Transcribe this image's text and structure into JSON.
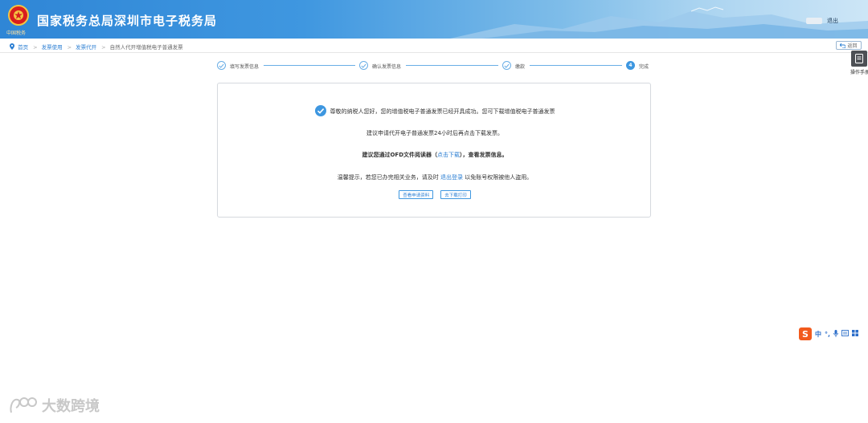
{
  "header": {
    "logo_caption": "中国税务",
    "title": "国家税务总局深圳市电子税务局",
    "logout": "退出"
  },
  "breadcrumb": {
    "items": [
      "首页",
      "发票使用",
      "发票代开",
      "自然人代开增值税电子普通发票"
    ]
  },
  "back_button": "返回",
  "guide_label": "操作手册",
  "steps": [
    {
      "label": "填写发票信息",
      "state": "done"
    },
    {
      "label": "确认发票信息",
      "state": "done"
    },
    {
      "label": "缴款",
      "state": "done"
    },
    {
      "label": "完成",
      "state": "active",
      "number": "4"
    }
  ],
  "result": {
    "success_message": "尊敬的纳税人您好，您的增值税电子普通发票已经开具成功。您可下载增值税电子普通发票",
    "suggest_line": "建议申请代开电子普通发票24小时后再点击下载发票。",
    "ofd_prefix": "建议您通过OFD文件阅读器（",
    "ofd_link": "点击下载",
    "ofd_suffix": "），查看发票信息。",
    "tip_prefix": "温馨提示，若您已办完相关业务，请及时",
    "tip_link": "退出登录",
    "tip_suffix": "以免账号权限被他人盗用。",
    "view_button": "查看申请资料",
    "download_button": "去下载打印"
  },
  "ime": {
    "logo": "S",
    "items": [
      "中",
      "°,",
      "🎤",
      "▤",
      "▦"
    ]
  },
  "watermark": "大数跨境",
  "colors": {
    "primary": "#3e97e0",
    "link": "#2c7fd3",
    "header_start": "#2f86d6",
    "ime_orange": "#f25a1d"
  }
}
